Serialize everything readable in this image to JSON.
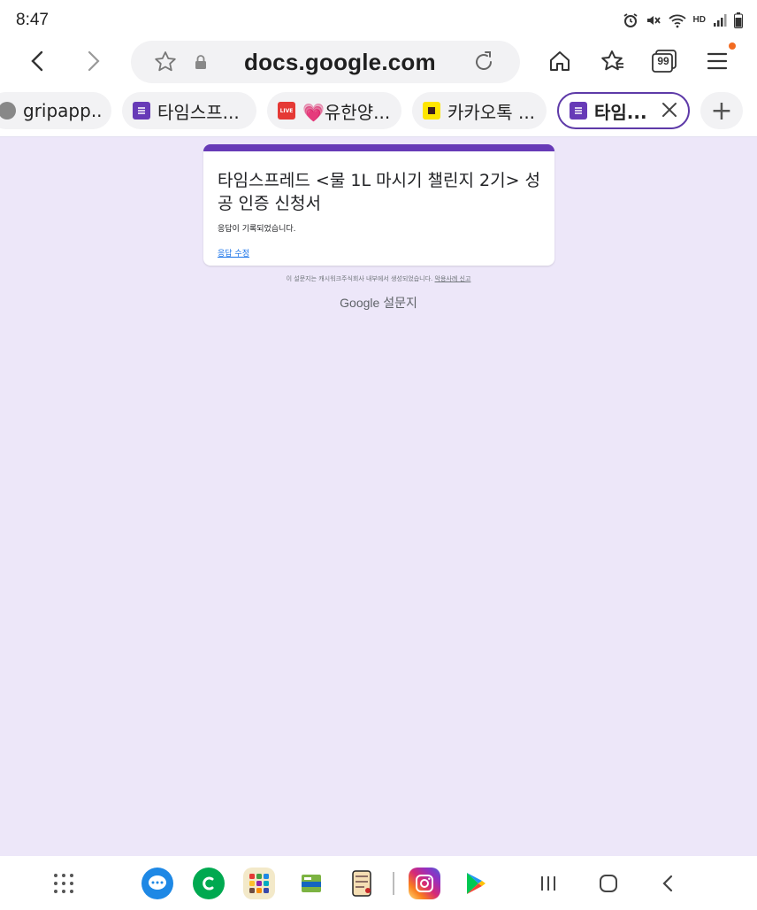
{
  "status_bar": {
    "time": "8:47",
    "network_label": "HD",
    "icons": [
      "alarm-icon",
      "mute-icon",
      "wifi-icon",
      "hd-voice-icon",
      "signal-icon",
      "battery-icon"
    ]
  },
  "browser": {
    "url": "docs.google.com",
    "tab_count": "99",
    "icons": [
      "back-icon",
      "forward-icon",
      "bookmark-star-icon",
      "lock-icon",
      "reload-icon",
      "home-icon",
      "bookmarks-icon",
      "tabs-icon",
      "menu-icon"
    ],
    "accent_color": "#5e3aa8",
    "notification_color": "#f26b21"
  },
  "tabs": [
    {
      "label": "gripapp...."
    },
    {
      "label": "타임스프..."
    },
    {
      "label": "💗유한양..."
    },
    {
      "label": "카카오톡 ..."
    },
    {
      "label": "타임..."
    }
  ],
  "new_tab_label": "+",
  "form": {
    "title": "타임스프레드 <물 1L 마시기 챌린지 2기> 성공 인증 신청서",
    "message": "응답이 기록되었습니다.",
    "edit_link": "응답 수정",
    "footer_note": "이 설문지는 캐시워크주식회사 내부에서 생성되었습니다.",
    "report_link": "악용사례 신고",
    "brand": "Google",
    "brand_suffix": "설문지",
    "theme_color": "#673ab7",
    "background_color": "#ede7f9"
  },
  "dock": {
    "apps": [
      "app-drawer-icon",
      "messages-app-icon",
      "kakao-c-app-icon",
      "app-folder-icon",
      "wallet-app-icon",
      "game-app-icon",
      "instagram-app-icon",
      "play-store-app-icon"
    ],
    "nav": [
      "recents-icon",
      "home-button-icon",
      "back-nav-icon"
    ]
  }
}
